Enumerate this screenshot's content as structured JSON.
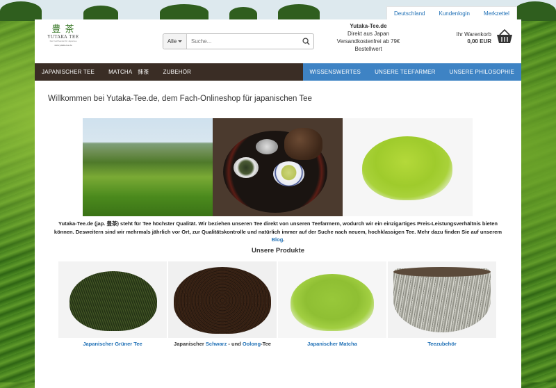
{
  "util_links": [
    "Deutschland",
    "Kundenlogin",
    "Merkzettel"
  ],
  "logo": {
    "mark": "豊 茶",
    "name": "YUTAKA TEE",
    "tagline": "Der Fachhandel für Japantee",
    "url": "www.yutaka-tee.de"
  },
  "search": {
    "category": "Alle",
    "placeholder": "Suche..."
  },
  "header_info": {
    "title": "Yutaka-Tee.de",
    "line1": "Direkt aus Japan",
    "line2": "Versandkostenfrei ab 79€ Bestellwert"
  },
  "cart": {
    "label": "Ihr Warenkorb",
    "amount": "0,00 EUR"
  },
  "nav": {
    "left": [
      "JAPANISCHER TEE",
      "MATCHA　抹茶",
      "ZUBEHÖR"
    ],
    "right": [
      "WISSENSWERTES",
      "UNSERE TEEFARMER",
      "UNSERE PHILOSOPHIE"
    ]
  },
  "welcome": "Willkommen bei Yutaka-Tee.de, dem Fach-Onlineshop für japanischen Tee",
  "intro": {
    "text": "Yutaka-Tee.de (jap. 豊茶) steht für Tee höchster Qualität. Wir beziehen unseren Tee direkt von unseren Teefarmern, wodurch wir ein einzigartiges Preis-Leistungsverhältnis bieten können. Desweitern sind wir mehrmals jährlich vor Ort, zur Qualitätskontrolle und natürlich immer auf der Suche nach neuem, hochklassigen Tee. Mehr dazu finden Sie auf unserem ",
    "link": "Blog",
    "end": "."
  },
  "section_title": "Unsere Produkte",
  "products": {
    "p1": "Japanischer Grüner Tee",
    "p2_pre": "Japanischer ",
    "p2_link1": "Schwarz",
    "p2_mid": " - und ",
    "p2_link2": "Oolong",
    "p2_post": "-Tee",
    "p3": "Japanischer Matcha",
    "p4": "Teezubehör"
  },
  "colors": {
    "nav_dark": "#3a2d25",
    "nav_blue": "#3e83c4",
    "link": "#1e6fb5"
  },
  "icons": {
    "search": "magnifier-icon",
    "cart": "shopping-basket-icon",
    "caret": "caret-down-icon"
  }
}
